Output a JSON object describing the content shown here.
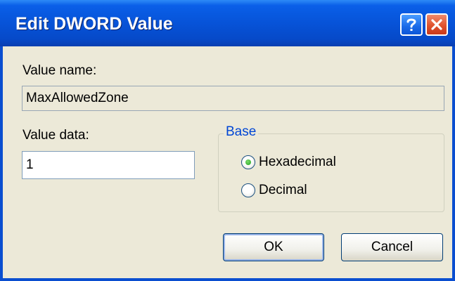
{
  "window": {
    "title": "Edit DWORD Value",
    "help_icon": "help-icon",
    "close_icon": "close-icon"
  },
  "value_name": {
    "label": "Value name:",
    "value": "MaxAllowedZone"
  },
  "value_data": {
    "label": "Value data:",
    "value": "1"
  },
  "base": {
    "title": "Base",
    "options": [
      {
        "label": "Hexadecimal",
        "selected": true
      },
      {
        "label": "Decimal",
        "selected": false
      }
    ]
  },
  "buttons": {
    "ok": "OK",
    "cancel": "Cancel"
  },
  "colors": {
    "titlebar": "#0753d8",
    "group_title": "#0046d5",
    "close_button": "#e0532e"
  }
}
